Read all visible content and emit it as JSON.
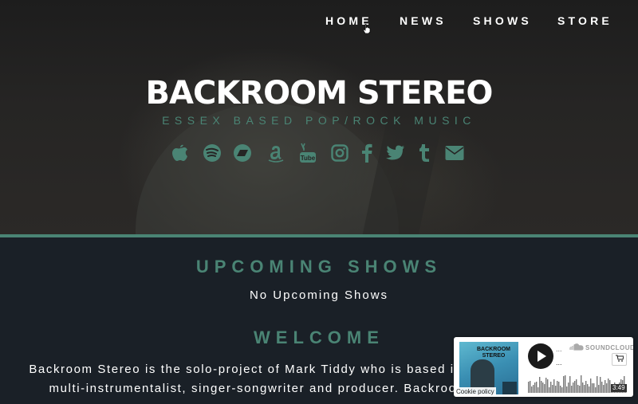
{
  "nav": {
    "items": [
      {
        "label": "HOME"
      },
      {
        "label": "NEWS"
      },
      {
        "label": "SHOWS"
      },
      {
        "label": "STORE"
      }
    ]
  },
  "hero": {
    "title": "BACKROOM STEREO",
    "tagline": "ESSEX BASED POP/ROCK MUSIC",
    "social_icons": [
      "apple-music-icon",
      "spotify-icon",
      "bandcamp-icon",
      "amazon-icon",
      "youtube-icon",
      "instagram-icon",
      "facebook-icon",
      "twitter-icon",
      "tumblr-icon",
      "email-icon"
    ]
  },
  "shows": {
    "heading": "UPCOMING SHOWS",
    "empty_text": "No Upcoming Shows"
  },
  "welcome": {
    "heading": "WELCOME",
    "lines": [
      "Backroom Stereo is the solo-project of Mark Tiddy who is based in",
      "multi-instrumentalist, singer-songwriter and producer. Backroo"
    ]
  },
  "player": {
    "art_label": "BACKROOM STEREO",
    "cookie_policy": "Cookie policy",
    "artist": "...",
    "track": "...",
    "brand": "SOUNDCLOUD",
    "duration": "3:49"
  },
  "colors": {
    "accent": "#4a8474",
    "background": "#1a2027"
  }
}
